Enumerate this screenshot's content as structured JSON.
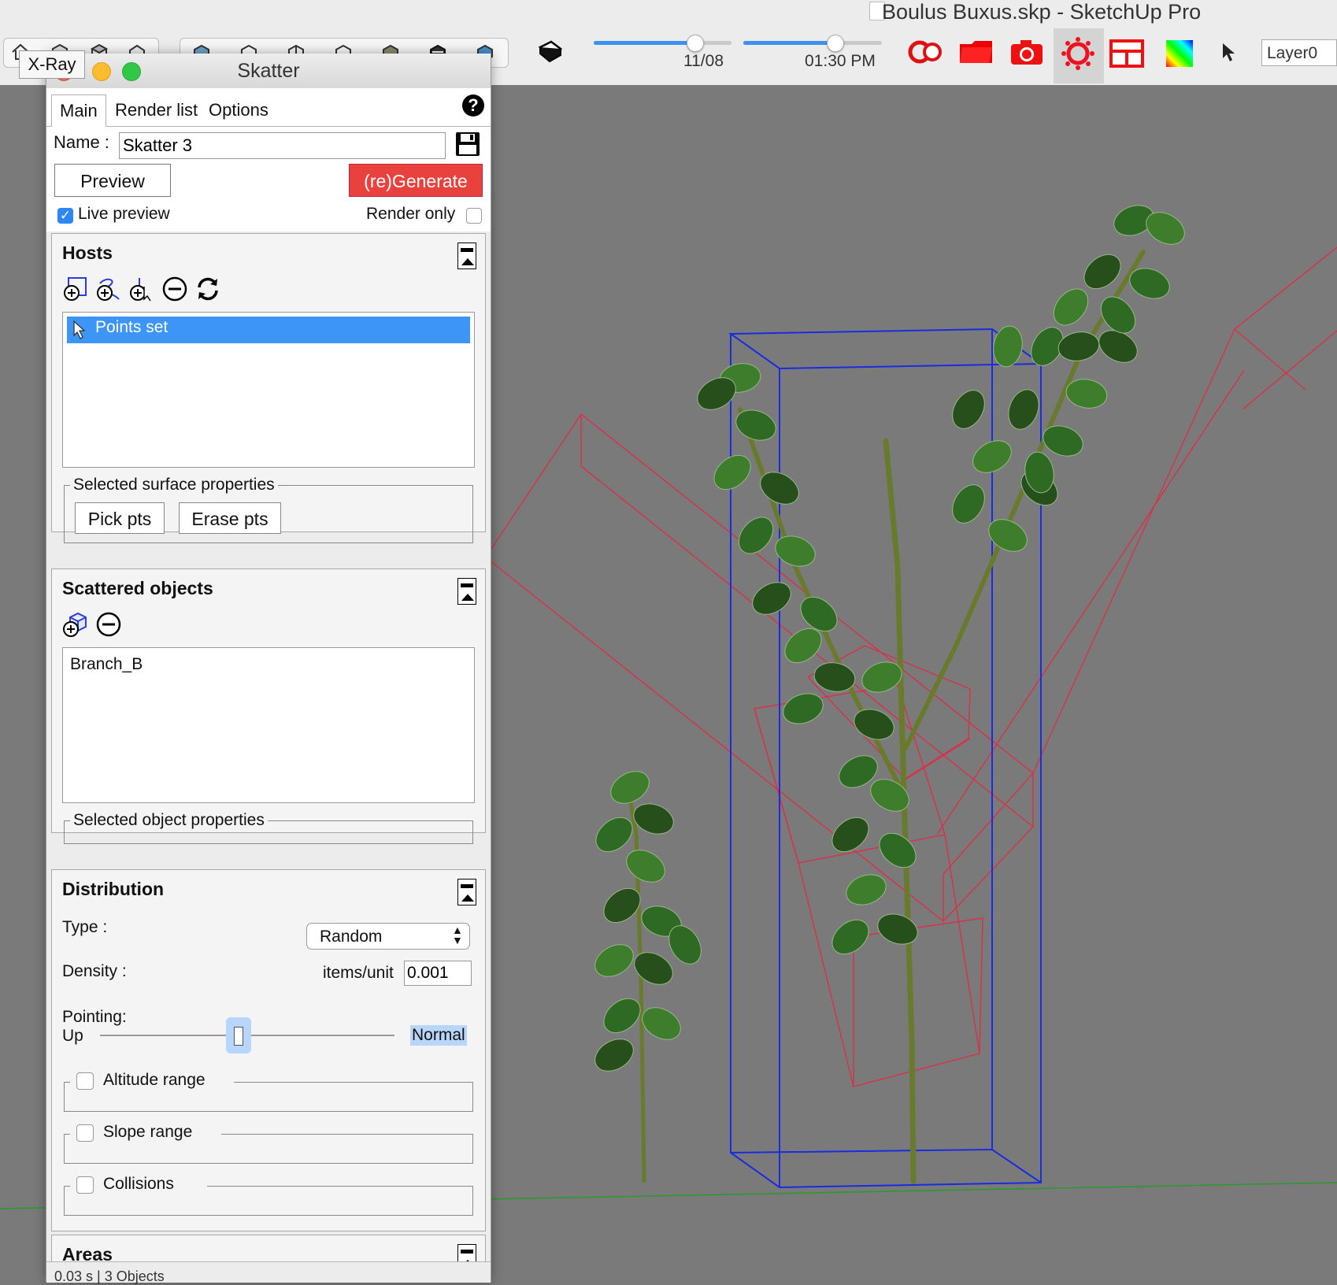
{
  "app": {
    "title": "Boulus Buxus.skp - SketchUp Pro",
    "date_value": "11/08",
    "time_value": "01:30 PM",
    "date_progress": 0.73,
    "time_progress": 0.66,
    "layer": "Layer0",
    "xray_tooltip": "X-Ray"
  },
  "skatter": {
    "window_title": "Skatter",
    "tabs": [
      "Main",
      "Render list",
      "Options"
    ],
    "help": "?",
    "name_label": "Name :",
    "name_value": "Skatter 3",
    "preview_button": "Preview",
    "generate_button": "(re)Generate",
    "live_preview_label": "Live preview",
    "live_preview_checked": true,
    "render_only_label": "Render only",
    "render_only_checked": false,
    "hosts": {
      "title": "Hosts",
      "toolbar_icons": [
        "add-face-icon",
        "add-curve-icon",
        "add-pick-icon",
        "remove-icon",
        "refresh-icon"
      ],
      "items": [
        "Points set"
      ],
      "selected_index": 0,
      "surface_props_legend": "Selected surface properties",
      "pick_button": "Pick pts",
      "erase_button": "Erase pts"
    },
    "scattered": {
      "title": "Scattered objects",
      "toolbar_icons": [
        "add-component-icon",
        "remove-icon"
      ],
      "items": [
        "Branch_B"
      ],
      "object_props_legend": "Selected object properties"
    },
    "distribution": {
      "title": "Distribution",
      "type_label": "Type :",
      "type_value": "Random",
      "density_label": "Density :",
      "density_unit": "items/unit",
      "density_value": "0.001",
      "pointing_label": "Pointing:",
      "pointing_up": "Up",
      "pointing_normal": "Normal",
      "pointing_value": 0.47,
      "altitude_label": "Altitude range",
      "slope_label": "Slope range",
      "collisions_label": "Collisions"
    },
    "areas": {
      "title": "Areas"
    },
    "status": "0.03 s | 3 Objects"
  }
}
